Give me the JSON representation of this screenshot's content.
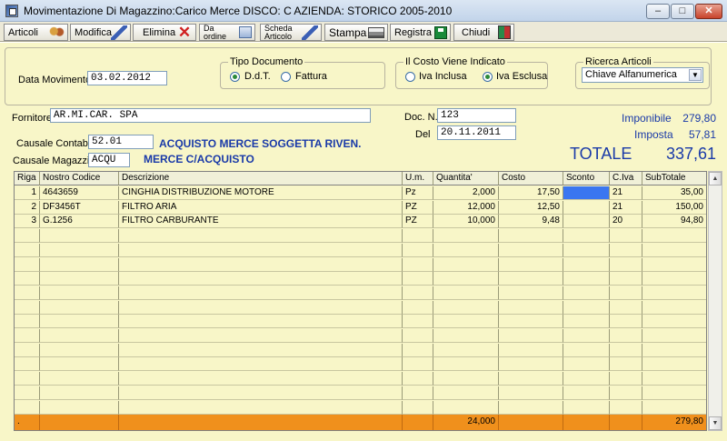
{
  "window": {
    "title": "Movimentazione Di Magazzino:Carico Merce    DISCO: C    AZIENDA: STORICO 2005-2010",
    "minimize": "–",
    "maximize": "□",
    "close": "✕"
  },
  "toolbar": {
    "articoli": "Articoli",
    "modifica": "Modifica",
    "elimina": "Elimina",
    "da_ordine_1": "Da",
    "da_ordine_2": "ordine",
    "scheda_1": "Scheda",
    "scheda_2": "Articolo",
    "stampa": "Stampa",
    "registra": "Registra",
    "chiudi": "Chiudi"
  },
  "header": {
    "data_movimento_label": "Data Movimento",
    "data_movimento": "03.02.2012",
    "tipo_documento": {
      "title": "Tipo Documento",
      "options": [
        "D.d.T.",
        "Fattura"
      ],
      "selected": "D.d.T."
    },
    "costo": {
      "title": "Il Costo Viene Indicato",
      "options": [
        "Iva Inclusa",
        "Iva Esclusa"
      ],
      "selected": "Iva Esclusa"
    },
    "ricerca": {
      "title": "Ricerca Articoli",
      "value": "Chiave Alfanumerica"
    }
  },
  "form": {
    "fornitore_label": "Fornitore",
    "fornitore": "AR.MI.CAR. SPA",
    "causale_contabile_label": "Causale Contabile",
    "causale_contabile": "52.01",
    "causale_contabile_desc": "ACQUISTO MERCE SOGGETTA RIVEN.",
    "causale_magazzino_label": "Causale Magazzino",
    "causale_magazzino": "ACQU",
    "causale_magazzino_desc": "MERCE C/ACQUISTO",
    "doc_n_label": "Doc. N.",
    "doc_n": "123",
    "del_label": "Del",
    "del": "20.11.2011"
  },
  "summary": {
    "imponibile_label": "Imponibile",
    "imponibile": "279,80",
    "imposta_label": "Imposta",
    "imposta": "57,81",
    "totale_label": "TOTALE",
    "totale": "337,61"
  },
  "grid": {
    "columns": [
      "Riga",
      "Nostro Codice",
      "Descrizione",
      "U.m.",
      "Quantita'",
      "Costo",
      "Sconto",
      "C.Iva",
      "SubTotale"
    ],
    "rows": [
      {
        "riga": "1",
        "codice": "4643659",
        "descrizione": "CINGHIA DISTRIBUZIONE MOTORE",
        "um": "Pz",
        "quantita": "2,000",
        "costo": "17,50",
        "sconto": "",
        "iva": "21",
        "subtotale": "35,00"
      },
      {
        "riga": "2",
        "codice": "DF3456T",
        "descrizione": "FILTRO ARIA",
        "um": "PZ",
        "quantita": "12,000",
        "costo": "12,50",
        "sconto": "",
        "iva": "21",
        "subtotale": "150,00"
      },
      {
        "riga": "3",
        "codice": "G.1256",
        "descrizione": "FILTRO CARBURANTE",
        "um": "PZ",
        "quantita": "10,000",
        "costo": "9,48",
        "sconto": "",
        "iva": "20",
        "subtotale": "94,80"
      }
    ],
    "footer": {
      "riga": ".",
      "quantita": "24,000",
      "subtotale": "279,80"
    }
  },
  "scrollbar": {
    "up": "▲",
    "down": "▼"
  }
}
